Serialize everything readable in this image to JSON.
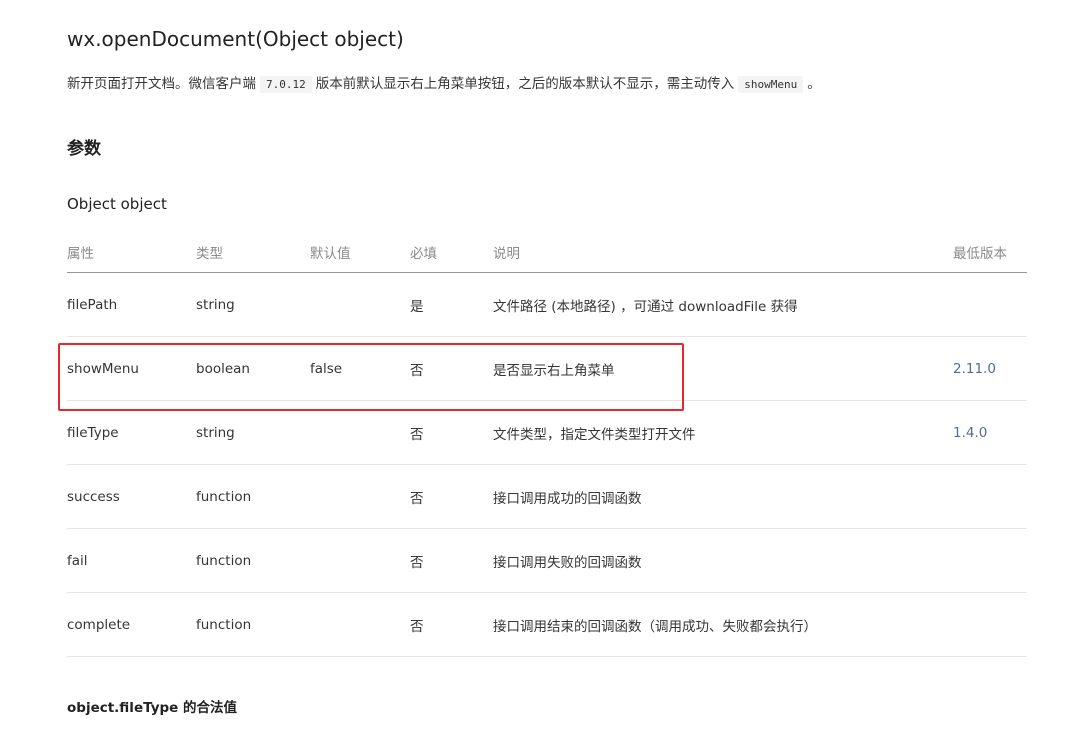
{
  "title": "wx.openDocument(Object object)",
  "description": {
    "text_before": "新开页面打开文档。微信客户端",
    "version_code": "7.0.12",
    "text_middle": "版本前默认显示右上角菜单按钮，之后的版本默认不显示，需主动传入",
    "param_code": "showMenu",
    "text_after": "。"
  },
  "params_heading": "参数",
  "object_heading": "Object object",
  "table": {
    "headers": {
      "name": "属性",
      "type": "类型",
      "default": "默认值",
      "required": "必填",
      "desc": "说明",
      "version": "最低版本"
    },
    "rows": [
      {
        "name": "filePath",
        "type": "string",
        "default": "",
        "required": "是",
        "desc": "文件路径 (本地路径) ，可通过 downloadFile 获得",
        "version": ""
      },
      {
        "name": "showMenu",
        "type": "boolean",
        "default": "false",
        "required": "否",
        "desc": "是否显示右上角菜单",
        "version": "2.11.0"
      },
      {
        "name": "fileType",
        "type": "string",
        "default": "",
        "required": "否",
        "desc": "文件类型，指定文件类型打开文件",
        "version": "1.4.0"
      },
      {
        "name": "success",
        "type": "function",
        "default": "",
        "required": "否",
        "desc": "接口调用成功的回调函数",
        "version": ""
      },
      {
        "name": "fail",
        "type": "function",
        "default": "",
        "required": "否",
        "desc": "接口调用失败的回调函数",
        "version": ""
      },
      {
        "name": "complete",
        "type": "function",
        "default": "",
        "required": "否",
        "desc": "接口调用结束的回调函数（调用成功、失败都会执行）",
        "version": ""
      }
    ]
  },
  "legal_values_heading": "object.fileType 的合法值",
  "highlight_color": "#e8262d",
  "link_color": "#576b95"
}
